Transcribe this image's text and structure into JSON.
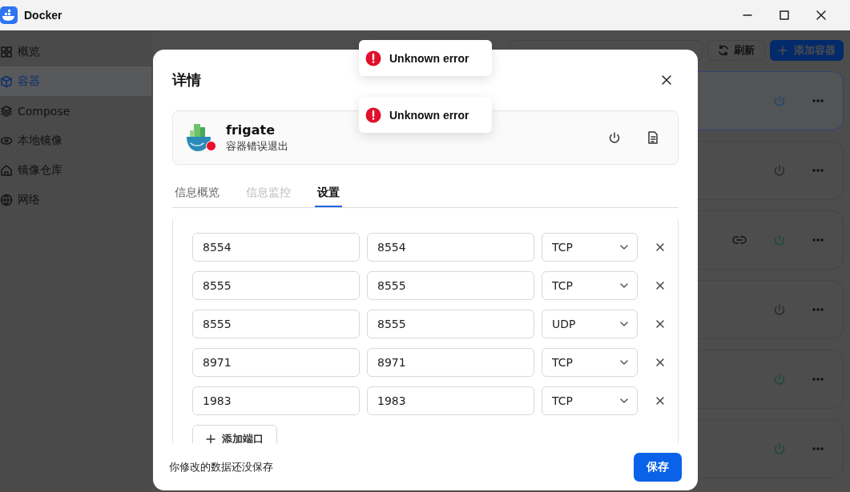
{
  "window": {
    "title": "Docker"
  },
  "sidebar": {
    "items": [
      {
        "label": "概览",
        "selected": false
      },
      {
        "label": "容器",
        "selected": true
      },
      {
        "label": "Compose",
        "selected": false
      },
      {
        "label": "本地镜像",
        "selected": false
      },
      {
        "label": "镜像仓库",
        "selected": false
      },
      {
        "label": "网络",
        "selected": false
      }
    ]
  },
  "main": {
    "refresh_button": "刷新",
    "add_button": "添加容器",
    "cards": [
      {
        "selected": true,
        "running": false,
        "has_link": false
      },
      {
        "selected": false,
        "running": false,
        "has_link": false
      },
      {
        "selected": false,
        "running": true,
        "has_link": true
      },
      {
        "selected": false,
        "running": false,
        "has_link": false
      },
      {
        "selected": false,
        "running": true,
        "has_link": false
      },
      {
        "selected": false,
        "running": true,
        "has_link": false
      }
    ]
  },
  "toasts": [
    {
      "message": "Unknown error"
    },
    {
      "message": "Unknown error"
    }
  ],
  "dialog": {
    "title": "详情",
    "container": {
      "name": "frigate",
      "error": true,
      "status_text": "容器错误退出"
    },
    "tabs": [
      {
        "label": "信息概览",
        "selected": false,
        "disabled": false
      },
      {
        "label": "信息监控",
        "selected": false,
        "disabled": true
      },
      {
        "label": "设置",
        "selected": true,
        "disabled": false
      }
    ],
    "ports": [
      {
        "host": "8554",
        "container": "8554",
        "protocol": "TCP"
      },
      {
        "host": "8555",
        "container": "8555",
        "protocol": "TCP"
      },
      {
        "host": "8555",
        "container": "8555",
        "protocol": "UDP"
      },
      {
        "host": "8971",
        "container": "8971",
        "protocol": "TCP"
      },
      {
        "host": "1983",
        "container": "1983",
        "protocol": "TCP"
      }
    ],
    "add_port_button": "添加端口",
    "footer_note": "你修改的数据还没保存",
    "save_button": "保存"
  }
}
